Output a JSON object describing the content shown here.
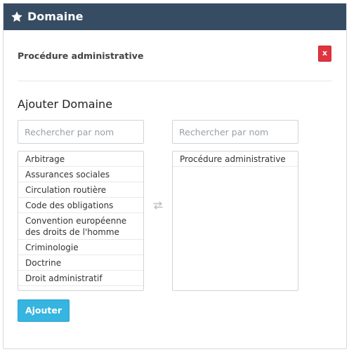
{
  "header": {
    "title": "Domaine",
    "icon": "star-icon"
  },
  "item": {
    "title": "Procédure administrative",
    "close_label": "x"
  },
  "form": {
    "title": "Ajouter Domaine",
    "left_search": {
      "placeholder": "Rechercher par nom",
      "value": ""
    },
    "right_search": {
      "placeholder": "Rechercher par nom",
      "value": ""
    },
    "available": [
      "Arbitrage",
      "Assurances sociales",
      "Circulation routière",
      "Code des obligations",
      "Convention européenne des droits de l'homme",
      "Criminologie",
      "Doctrine",
      "Droit administratif"
    ],
    "selected": [
      "Procédure administrative"
    ],
    "transfer_icon": "transfer-arrows-icon",
    "submit_label": "Ajouter"
  },
  "colors": {
    "header_bg": "#364c63",
    "danger": "#e0343f",
    "primary": "#35b5e0"
  }
}
